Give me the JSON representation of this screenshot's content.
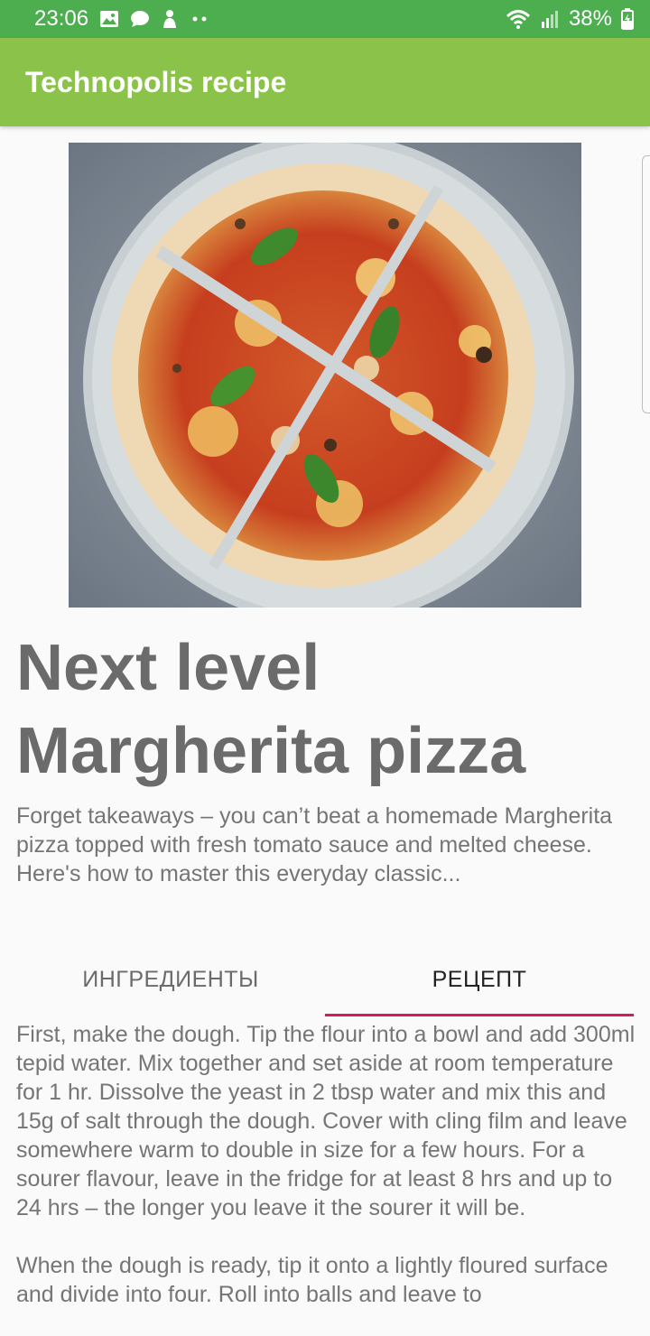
{
  "status_bar": {
    "time": "23:06",
    "notification_icons": [
      "image-icon",
      "chat-bubble-icon",
      "app-notification-icon",
      "more-dots-icon"
    ],
    "wifi_icon": "wifi-icon",
    "signal_icon": "cell-signal-icon",
    "battery_percent": "38%",
    "battery_icon": "battery-charging-icon",
    "color": "#4cae4f"
  },
  "app_bar": {
    "title": "Technopolis recipe",
    "color": "#8bc34a"
  },
  "recipe": {
    "image": "margherita-pizza-photo",
    "title": "Next level Margherita pizza",
    "description": "Forget takeaways – you can’t beat a homemade Margherita pizza topped with fresh tomato sauce and melted cheese. Here's how to master this everyday classic...",
    "tabs": [
      {
        "label": "ИНГРЕДИЕНТЫ",
        "selected": false
      },
      {
        "label": "РЕЦЕПТ",
        "selected": true
      }
    ],
    "tab_indicator_color": "#d81b60",
    "steps": [
      "First, make the dough. Tip the flour into a bowl and add 300ml tepid water. Mix together and set aside at room temperature for 1 hr. Dissolve the yeast in 2 tbsp water and mix this and 15g of salt through the dough. Cover with cling film and leave somewhere warm to double in size for a few hours. For a sourer flavour, leave in the fridge for at least 8 hrs and up to 24 hrs – the longer you leave it the sourer it will be.",
      "When the dough is ready, tip it onto a lightly floured surface and divide into four. Roll into balls and leave to"
    ]
  }
}
